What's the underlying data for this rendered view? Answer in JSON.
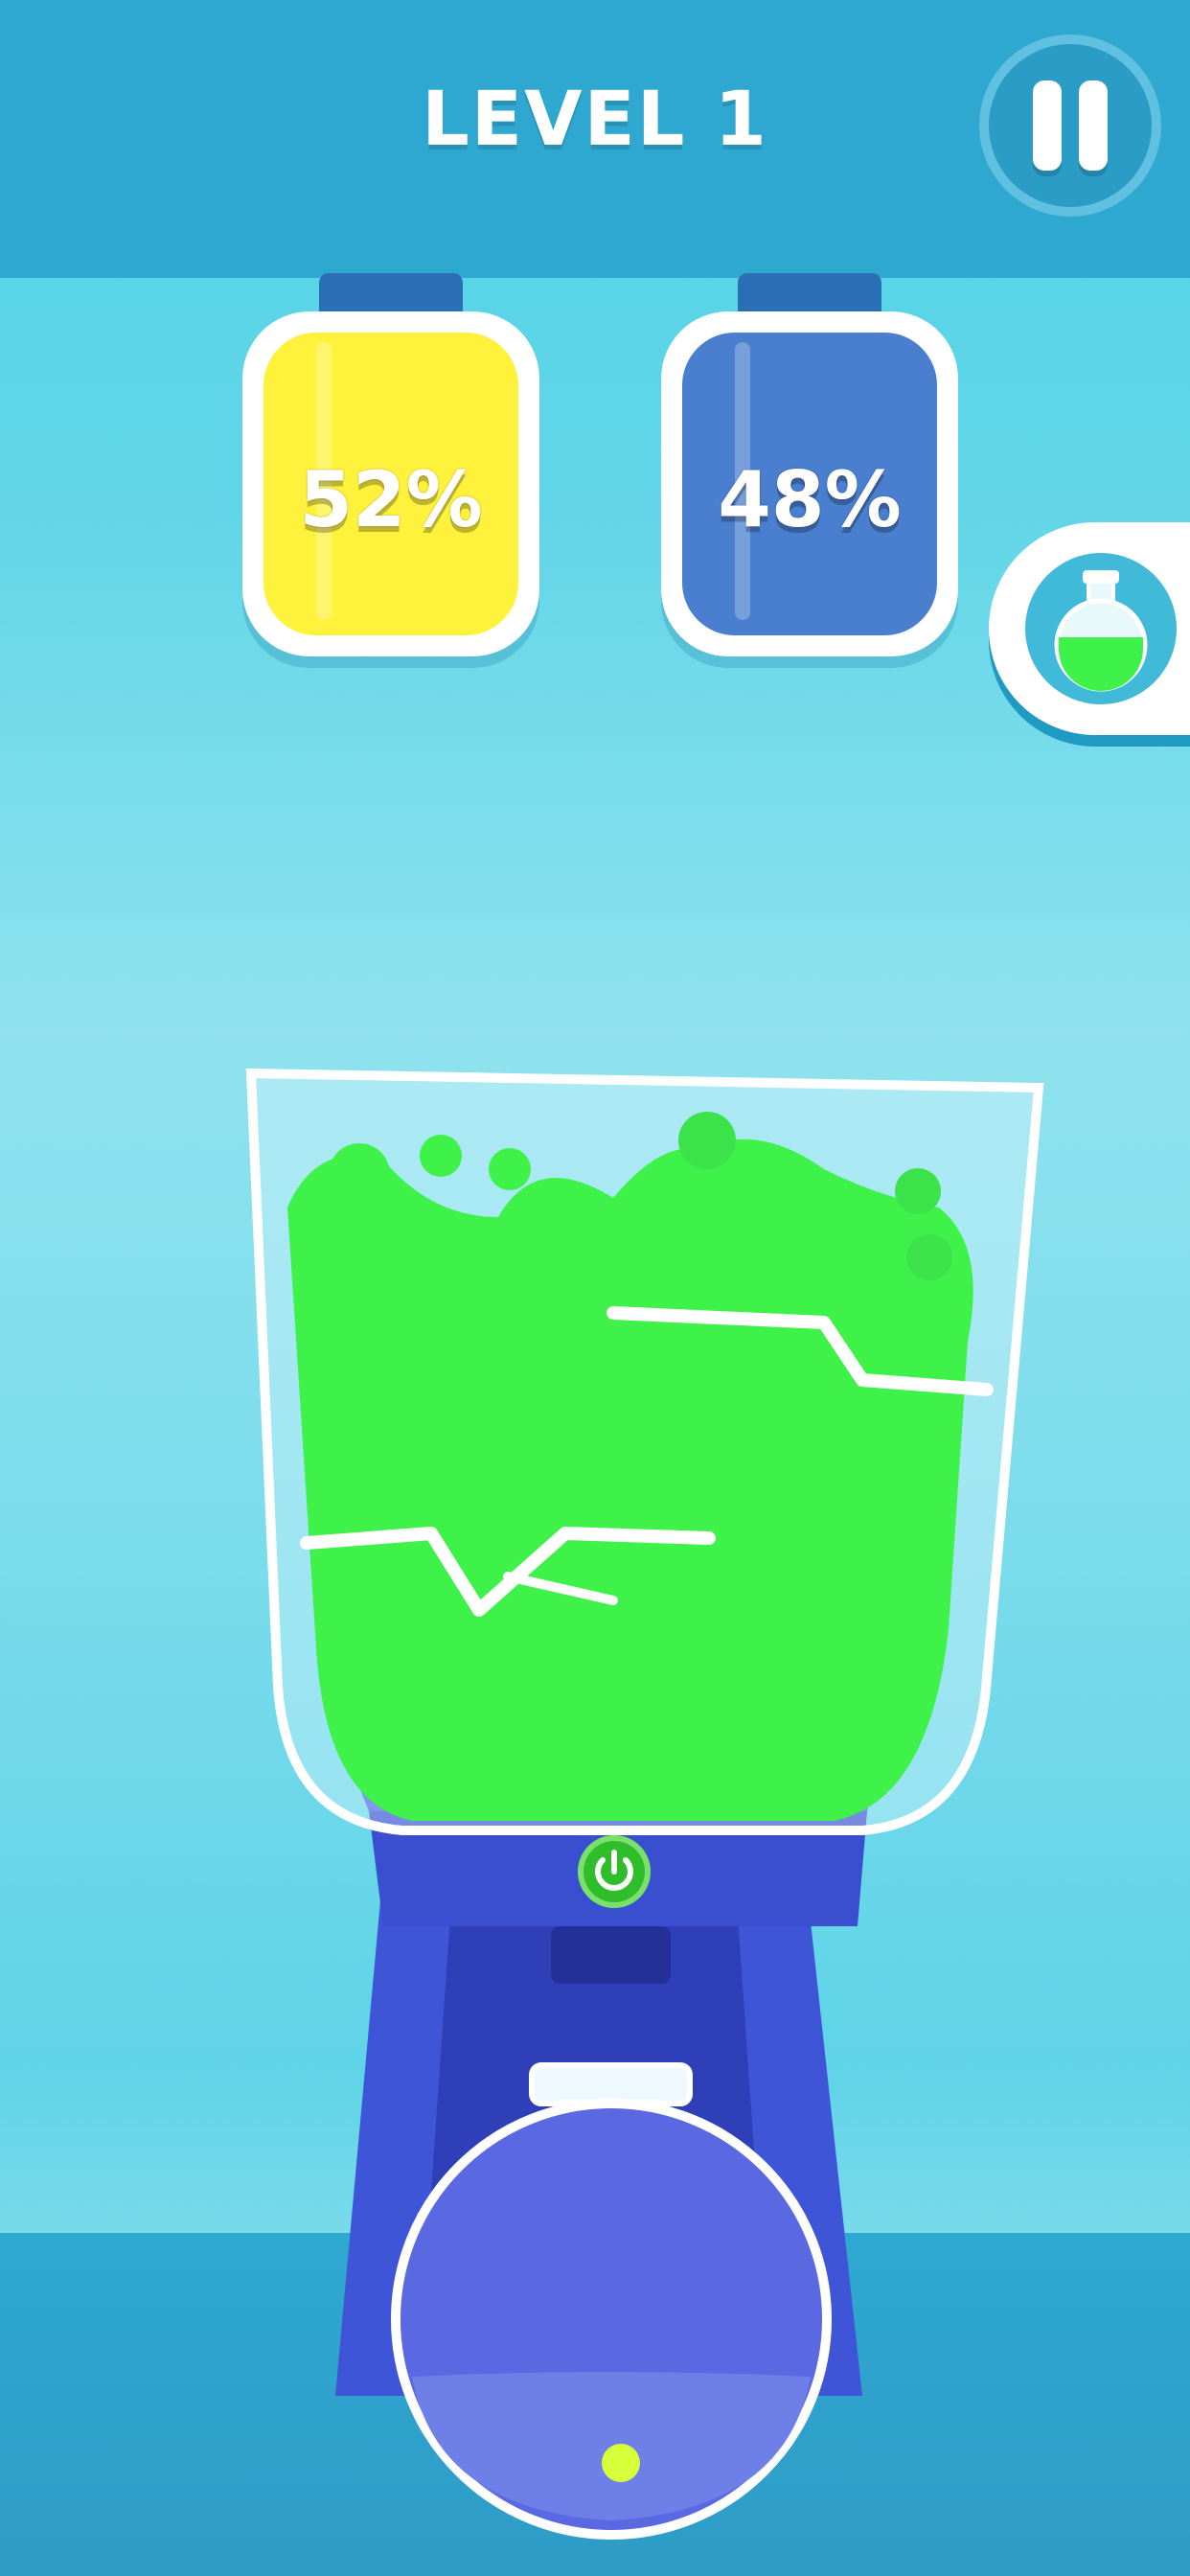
{
  "header": {
    "level_label": "LEVEL 1"
  },
  "jars": [
    {
      "percent": "52%",
      "color": "#fff23d"
    },
    {
      "percent": "48%",
      "color": "#4a7fd0"
    }
  ],
  "colors": {
    "mix_green": "#3ff24a",
    "blender_blue": "#3f55d8"
  },
  "icons": {
    "pause": "pause-icon",
    "potion": "potion-flask-icon",
    "power": "power-icon"
  }
}
